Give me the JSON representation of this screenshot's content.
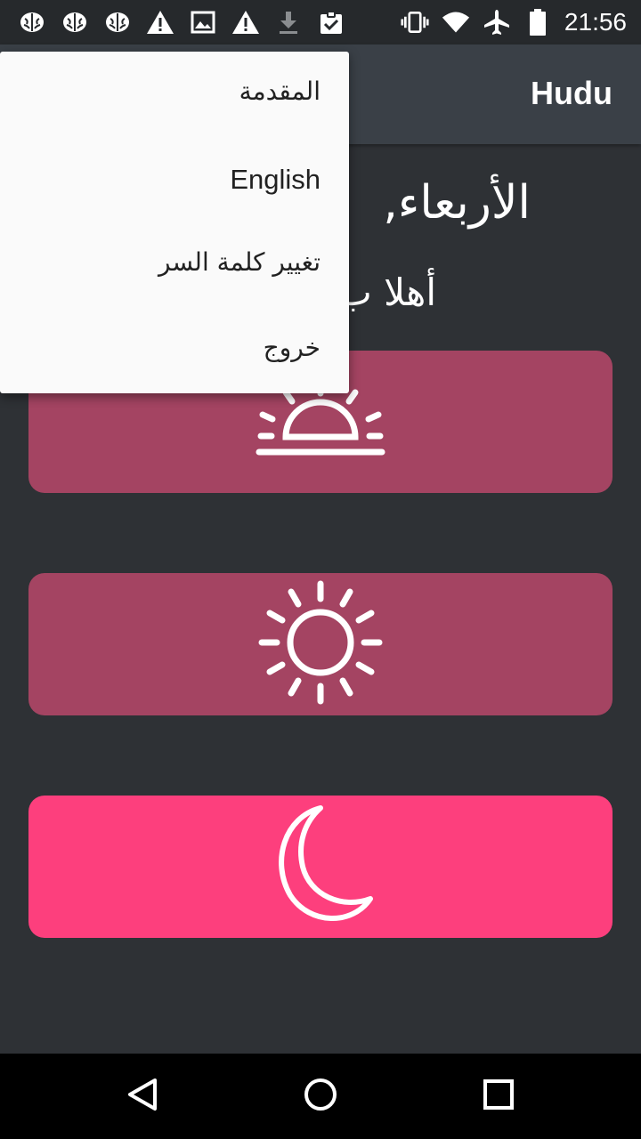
{
  "status_bar": {
    "time": "21:56",
    "notification_icons": [
      "brain-icon",
      "brain-icon",
      "brain-icon",
      "warning-icon",
      "image-icon",
      "warning-icon",
      "download-icon",
      "clipboard-check-icon"
    ],
    "system_icons": [
      "vibrate-icon",
      "wifi-icon",
      "airplane-icon",
      "battery-icon"
    ]
  },
  "app_bar": {
    "title": "Hudu"
  },
  "main": {
    "greeting": "الأربعاء,",
    "welcome": "أهلا ب"
  },
  "cards": [
    {
      "icon": "sunrise-icon",
      "color": "#a44462"
    },
    {
      "icon": "sun-icon",
      "color": "#a44462"
    },
    {
      "icon": "moon-icon",
      "color": "#fd3f7d"
    }
  ],
  "overflow_menu": {
    "items": [
      {
        "label": "المقدمة"
      },
      {
        "label": "English"
      },
      {
        "label": "تغيير كلمة السر"
      },
      {
        "label": "خروج"
      }
    ]
  },
  "nav_bar": {
    "buttons": [
      "back-icon",
      "home-icon",
      "recents-icon"
    ]
  },
  "colors": {
    "background": "#2e3135",
    "app_bar": "#3a4047",
    "card_muted": "#a44462",
    "card_accent": "#fd3f7d"
  }
}
